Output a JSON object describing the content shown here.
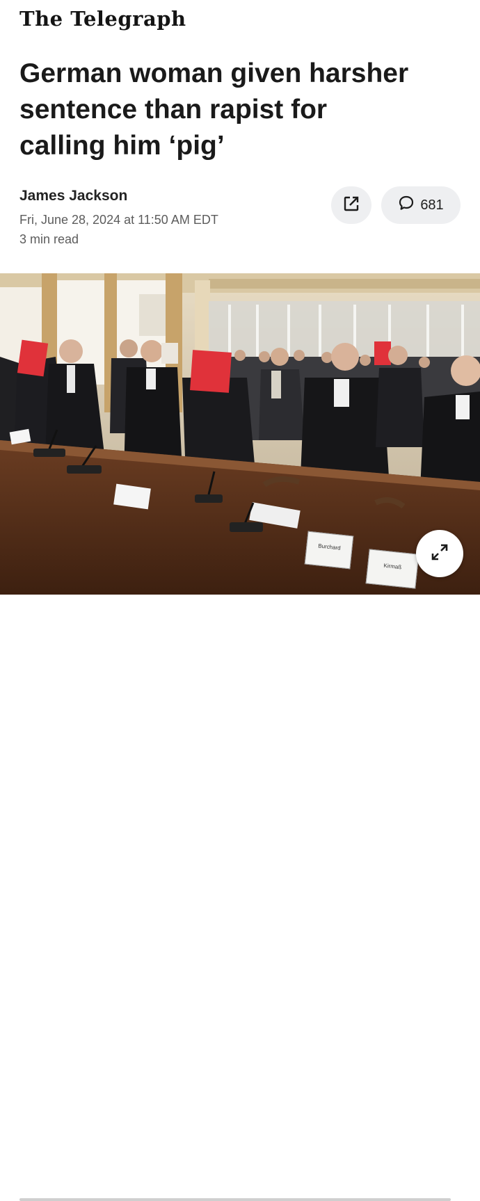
{
  "masthead": "The Telegraph",
  "headline": {
    "lines": [
      "German woman given harsher",
      "sentence than rapist for",
      "calling him ‘pig’"
    ]
  },
  "byline": {
    "author": "James Jackson",
    "date": "Fri, June 28, 2024 at 11:50 AM EDT",
    "read_time": "3 min read"
  },
  "actions": {
    "share_icon": "share-external-icon",
    "comments_icon": "speech-bubble-icon",
    "comment_count": "681"
  },
  "photo": {
    "name_plates": [
      "Burchard",
      "Kirmaß"
    ],
    "expand_icon": "expand-arrows-icon"
  },
  "colors": {
    "background": "#ffffff",
    "button_bg": "#eeeff1",
    "red_folder": "#e0323a"
  }
}
